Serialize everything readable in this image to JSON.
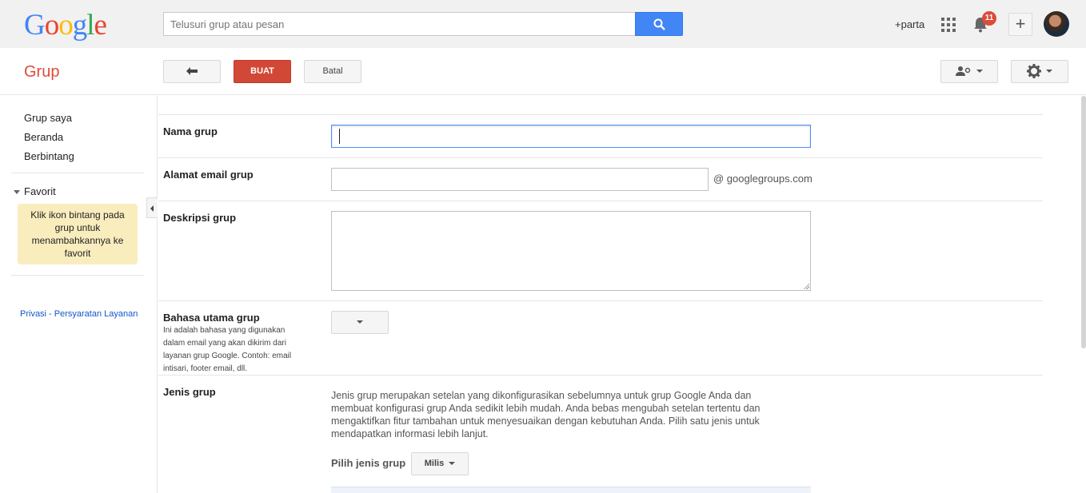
{
  "header": {
    "logo_text": "Google",
    "logo_colors": [
      "#4285f4",
      "#ea4335",
      "#fbbc05",
      "#4285f4",
      "#34a853",
      "#ea4335"
    ],
    "search_placeholder": "Telusuri grup atau pesan",
    "user_name": "+parta",
    "notification_count": "11"
  },
  "toolbar": {
    "app_title": "Grup",
    "create_label": "BUAT",
    "cancel_label": "Batal"
  },
  "sidebar": {
    "items": [
      {
        "label": "Grup saya"
      },
      {
        "label": "Beranda"
      },
      {
        "label": "Berbintang"
      }
    ],
    "favorites_label": "Favorit",
    "favorites_hint": "Klik ikon bintang pada grup untuk menambahkannya ke favorit",
    "footer_links": "Privasi - Persyaratan Layanan"
  },
  "form": {
    "group_name_label": "Nama grup",
    "group_name_value": "",
    "email_label": "Alamat email grup",
    "email_value": "",
    "email_suffix": "@ googlegroups.com",
    "description_label": "Deskripsi grup",
    "description_value": "",
    "language_label": "Bahasa utama grup",
    "language_help": "Ini adalah bahasa yang digunakan dalam email yang akan dikirim dari layanan grup Google. Contoh: email intisari, footer email, dll.",
    "group_type_label": "Jenis grup",
    "group_type_description": "Jenis grup merupakan setelan yang dikonfigurasikan sebelumnya untuk grup Google Anda dan membuat konfigurasi grup Anda sedikit lebih mudah. Anda bebas mengubah setelan tertentu dan mengaktifkan fitur tambahan untuk menyesuaikan dengan kebutuhan Anda. Pilih satu jenis untuk mendapatkan informasi lebih lanjut.",
    "pick_type_label": "Pilih jenis grup",
    "pick_type_value": "Milis"
  },
  "colors": {
    "accent_red": "#dd4b39",
    "search_blue": "#4285f4",
    "link_blue": "#1155cc"
  }
}
